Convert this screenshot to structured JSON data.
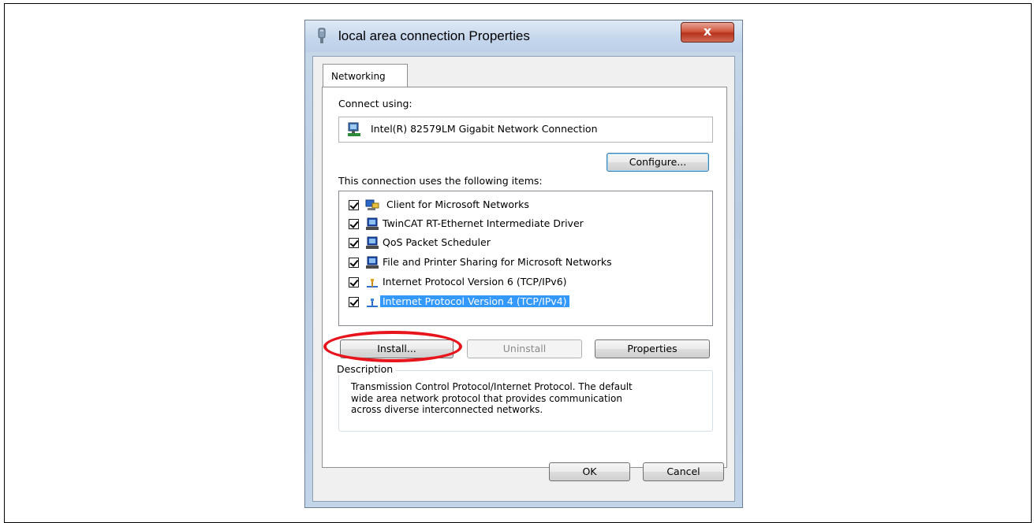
{
  "dialog": {
    "title": "local area connection Properties",
    "close_label": "x"
  },
  "tabs": [
    {
      "label": "Networking"
    }
  ],
  "connect_using": {
    "label": "Connect using:",
    "adapter_name": "Intel(R) 82579LM Gigabit Network Connection",
    "configure_label": "Configure..."
  },
  "items_section": {
    "label": "This connection uses the following items:",
    "items": [
      {
        "label": "Client for Microsoft Networks",
        "checked": true,
        "icon": "client-network-icon"
      },
      {
        "label": "TwinCAT RT-Ethernet Intermediate Driver",
        "checked": true,
        "icon": "network-service-icon"
      },
      {
        "label": "QoS Packet Scheduler",
        "checked": true,
        "icon": "network-service-icon"
      },
      {
        "label": "File and Printer Sharing for Microsoft Networks",
        "checked": true,
        "icon": "network-service-icon"
      },
      {
        "label": "Internet Protocol Version 6 (TCP/IPv6)",
        "checked": true,
        "icon": "protocol-icon"
      },
      {
        "label": "Internet Protocol Version 4 (TCP/IPv4)",
        "checked": true,
        "icon": "protocol-icon",
        "selected": true
      }
    ]
  },
  "actions": {
    "install": "Install...",
    "uninstall": "Uninstall",
    "properties": "Properties"
  },
  "description": {
    "legend": "Description",
    "line1": "Transmission Control Protocol/Internet Protocol. The default",
    "line2": "wide area network protocol that provides communication",
    "line3": "across diverse interconnected networks."
  },
  "footer": {
    "ok": "OK",
    "cancel": "Cancel"
  },
  "colors": {
    "selection": "#3399ff",
    "highlight_ellipse": "#e8141c",
    "close_button": "#c7472f"
  }
}
